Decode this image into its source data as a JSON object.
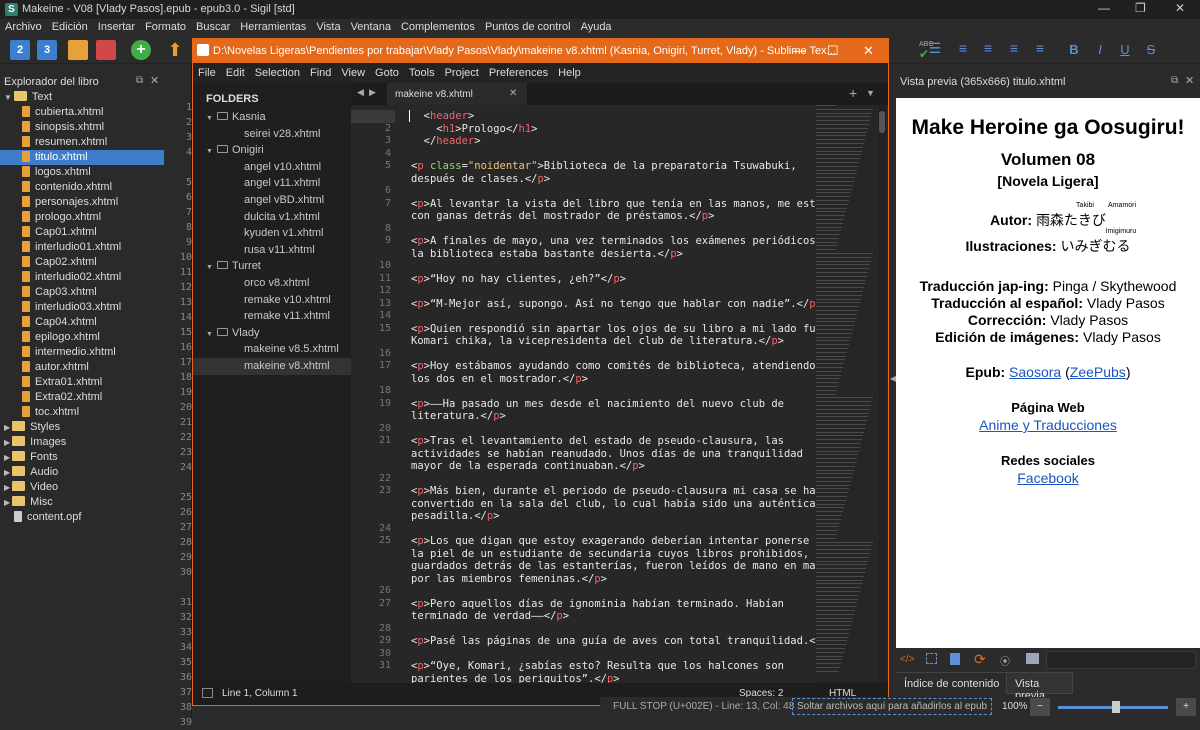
{
  "title": "Makeine - V08 [Vlady Pasos].epub - epub3.0 - Sigil [std]",
  "menu": [
    "Archivo",
    "Edición",
    "Insertar",
    "Formato",
    "Buscar",
    "Herramientas",
    "Vista",
    "Ventana",
    "Complementos",
    "Puntos de control",
    "Ayuda"
  ],
  "book_browser": {
    "title": "Explorador del libro",
    "root": "Text",
    "files": [
      "cubierta.xhtml",
      "sinopsis.xhtml",
      "resumen.xhtml",
      "titulo.xhtml",
      "logos.xhtml",
      "contenido.xhtml",
      "personajes.xhtml",
      "prologo.xhtml",
      "Cap01.xhtml",
      "interludio01.xhtml",
      "Cap02.xhtml",
      "interludio02.xhtml",
      "Cap03.xhtml",
      "interludio03.xhtml",
      "Cap04.xhtml",
      "epilogo.xhtml",
      "intermedio.xhtml",
      "autor.xhtml",
      "Extra01.xhtml",
      "Extra02.xhtml",
      "toc.xhtml"
    ],
    "selected": "titulo.xhtml",
    "folders": [
      "Styles",
      "Images",
      "Fonts",
      "Audio",
      "Video",
      "Misc"
    ],
    "opf": "content.opf"
  },
  "behind_gutter": [
    "1",
    "2",
    "3",
    "4",
    "",
    "5",
    "6",
    "7",
    "8",
    "9",
    "10",
    "11",
    "12",
    "13",
    "14",
    "15",
    "16",
    "17",
    "18",
    "19",
    "20",
    "21",
    "22",
    "23",
    "24",
    "",
    "25",
    "26",
    "27",
    "28",
    "29",
    "30",
    "",
    "31",
    "32",
    "33",
    "34",
    "35",
    "36",
    "37",
    "38",
    "39"
  ],
  "sublime": {
    "title": "D:\\Novelas Ligeras\\Pendientes por trabajar\\Vlady Pasos\\Vlady\\makeine v8.xhtml (Kasnia, Onigiri, Turret, Vlady) - Sublime Tex...",
    "menu": [
      "File",
      "Edit",
      "Selection",
      "Find",
      "View",
      "Goto",
      "Tools",
      "Project",
      "Preferences",
      "Help"
    ],
    "folders_header": "FOLDERS",
    "tree": [
      {
        "level": 0,
        "text": "Kasnia"
      },
      {
        "level": 1,
        "text": "seirei v28.xhtml"
      },
      {
        "level": 0,
        "text": "Onigiri"
      },
      {
        "level": 1,
        "text": "angel v10.xhtml"
      },
      {
        "level": 1,
        "text": "angel v11.xhtml"
      },
      {
        "level": 1,
        "text": "angel vBD.xhtml"
      },
      {
        "level": 1,
        "text": "dulcita v1.xhtml"
      },
      {
        "level": 1,
        "text": "kyuden v1.xhtml"
      },
      {
        "level": 1,
        "text": "rusa v11.xhtml"
      },
      {
        "level": 0,
        "text": "Turret"
      },
      {
        "level": 1,
        "text": "orco v8.xhtml"
      },
      {
        "level": 1,
        "text": "remake v10.xhtml"
      },
      {
        "level": 1,
        "text": "remake v11.xhtml"
      },
      {
        "level": 0,
        "text": "Vlady"
      },
      {
        "level": 1,
        "text": "makeine v8.5.xhtml"
      },
      {
        "level": 1,
        "text": "makeine v8.xhtml"
      }
    ],
    "tab": "makeine v8.xhtml",
    "lines": [
      {
        "n": "1",
        "c": "  <header>"
      },
      {
        "n": "2",
        "c": "    <h1>Prologo</h1>"
      },
      {
        "n": "3",
        "c": "  </header>"
      },
      {
        "n": "4",
        "c": ""
      },
      {
        "n": "5",
        "c": "<p class=\"noidentar\">Biblioteca de la preparatoria Tsuwabuki,"
      },
      {
        "n": "",
        "c": "después de clases.</p>"
      },
      {
        "n": "6",
        "c": ""
      },
      {
        "n": "7",
        "c": "<p>Al levantar la vista del libro que tenía en las manos, me estiré"
      },
      {
        "n": "",
        "c": "con ganas detrás del mostrador de préstamos.</p>"
      },
      {
        "n": "8",
        "c": ""
      },
      {
        "n": "9",
        "c": "<p>A finales de mayo, una vez terminados los exámenes periódicos,"
      },
      {
        "n": "",
        "c": "la biblioteca estaba bastante desierta.</p>"
      },
      {
        "n": "10",
        "c": ""
      },
      {
        "n": "11",
        "c": "<p>“Hoy no hay clientes, ¿eh?”</p>"
      },
      {
        "n": "12",
        "c": ""
      },
      {
        "n": "13",
        "c": "<p>“M-Mejor así, supongo. Así no tengo que hablar con nadie”.</p>"
      },
      {
        "n": "14",
        "c": ""
      },
      {
        "n": "15",
        "c": "<p>Quien respondió sin apartar los ojos de su libro a mi lado fue"
      },
      {
        "n": "",
        "c": "Komari chika, la vicepresidenta del club de literatura.</p>"
      },
      {
        "n": "16",
        "c": ""
      },
      {
        "n": "17",
        "c": "<p>Hoy estábamos ayudando como comités de biblioteca, atendiendo"
      },
      {
        "n": "",
        "c": "los dos en el mostrador.</p>"
      },
      {
        "n": "18",
        "c": ""
      },
      {
        "n": "19",
        "c": "<p>——Ha pasado un mes desde el nacimiento del nuevo club de"
      },
      {
        "n": "",
        "c": "literatura.</p>"
      },
      {
        "n": "20",
        "c": ""
      },
      {
        "n": "21",
        "c": "<p>Tras el levantamiento del estado de pseudo-clausura, las"
      },
      {
        "n": "",
        "c": "actividades se habían reanudado. Unos días de una tranquilidad"
      },
      {
        "n": "",
        "c": "mayor de la esperada continuaban.</p>"
      },
      {
        "n": "22",
        "c": ""
      },
      {
        "n": "23",
        "c": "<p>Más bien, durante el periodo de pseudo-clausura mi casa se había"
      },
      {
        "n": "",
        "c": "convertido en la sala del club, lo cual había sido una auténtica"
      },
      {
        "n": "",
        "c": "pesadilla.</p>"
      },
      {
        "n": "24",
        "c": ""
      },
      {
        "n": "25",
        "c": "<p>Los que digan que estoy exagerando deberían intentar ponerse en"
      },
      {
        "n": "",
        "c": "la piel de un estudiante de secundaria cuyos libros prohibidos,"
      },
      {
        "n": "",
        "c": "guardados detrás de las estanterías, fueron leídos de mano en mano"
      },
      {
        "n": "",
        "c": "por las miembros femeninas.</p>"
      },
      {
        "n": "26",
        "c": ""
      },
      {
        "n": "27",
        "c": "<p>Pero aquellos días de ignominia habían terminado. Habían"
      },
      {
        "n": "",
        "c": "terminado de verdad——</p>"
      },
      {
        "n": "28",
        "c": ""
      },
      {
        "n": "29",
        "c": "<p>Pasé las páginas de una guía de aves con total tranquilidad.</p>"
      },
      {
        "n": "30",
        "c": ""
      },
      {
        "n": "31",
        "c": "<p>“Oye, Komari, ¿sabías esto? Resulta que los halcones son"
      },
      {
        "n": "",
        "c": "parientes de los periquitos”.</p>"
      }
    ],
    "status_left": "Line 1, Column 1",
    "status_spaces": "Spaces: 2",
    "status_syntax": "HTML"
  },
  "preview_panel": {
    "title": "Vista previa (365x666) titulo.xhtml",
    "h1": "Make Heroine ga Oosugiru!",
    "volume": "Volumen 08",
    "novel": "[Novela Ligera]",
    "author_label": "Autor:",
    "author_kanji": "雨森たきび",
    "ruby_takibi": "Takibi",
    "ruby_amamori": "Amamori",
    "illus_label": "Ilustraciones:",
    "illus_name": "いみぎむる",
    "ruby_imigimuru": "Imigimuru",
    "c1_label": "Traducción jap-ing:",
    "c1_val": "Pinga / Skythewood",
    "c2_label": "Traducción al español:",
    "c2_val": "Vlady Pasos",
    "c3_label": "Corrección:",
    "c3_val": "Vlady Pasos",
    "c4_label": "Edición de imágenes:",
    "c4_val": "Vlady Pasos",
    "epub_label": "Epub:",
    "epub_link1": "Saosora",
    "epub_paren_open": "(",
    "epub_link2": "ZeePubs",
    "epub_paren_close": ")",
    "web_label": "Página Web",
    "web_link": "Anime y Traducciones",
    "social_label": "Redes sociales",
    "social_link": "Facebook",
    "tab_toc": "Índice de contenido",
    "tab_preview": "Vista previa"
  },
  "bottom_status": {
    "char": "FULL STOP (U+002E) - Line: 13, Col: 48",
    "drop": "Soltar archivos aquí para añadirlos al epub",
    "zoom": "100%"
  },
  "colors": {
    "accent": "#e5691a",
    "selection": "#3d7cc9",
    "tag": "#f2636b",
    "attr": "#9ed36a",
    "string": "#f0c674"
  }
}
